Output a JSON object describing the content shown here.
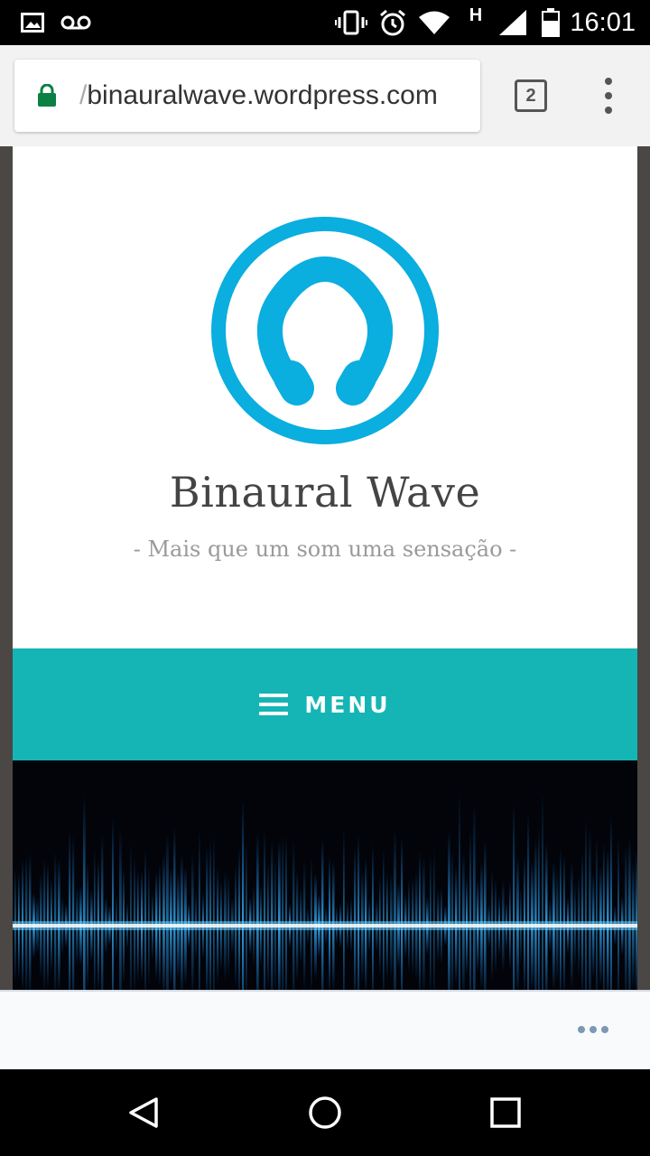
{
  "status_bar": {
    "time": "16:01",
    "icons": [
      "gallery-icon",
      "voicemail-icon",
      "vibrate-icon",
      "alarm-icon",
      "wifi-icon",
      "h-network-icon",
      "signal-icon",
      "battery-icon"
    ],
    "network_type": "H"
  },
  "browser": {
    "url_prefix": "/",
    "url": "binauralwave.wordpress.com",
    "tab_count": "2",
    "secure_color": "#0b8043"
  },
  "site": {
    "title": "Binaural Wave",
    "tagline": "- Mais que um som uma sensação -",
    "menu_label": "MENU",
    "accent_color": "#15b5b5",
    "logo_color": "#0aaedf",
    "logo_icon": "headphones-icon"
  },
  "bottom_sheet": {
    "more_icon": "more-horizontal-icon"
  },
  "nav_bar": {
    "icons": [
      "back-icon",
      "home-icon",
      "recents-icon"
    ]
  }
}
